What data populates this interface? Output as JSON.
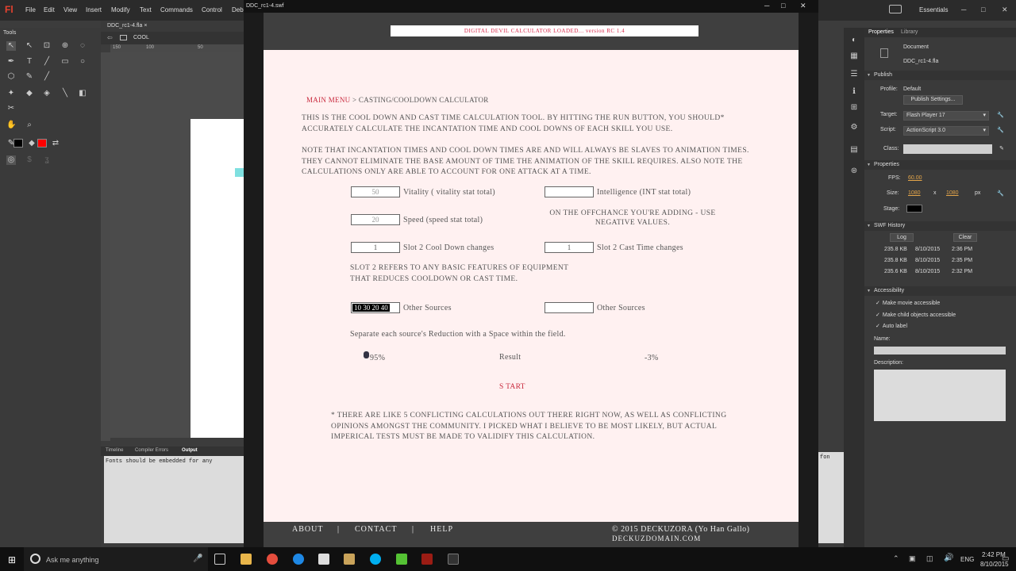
{
  "ide": {
    "logo": "Fl",
    "menus": [
      "File",
      "Edit",
      "View",
      "Insert",
      "Modify",
      "Text",
      "Commands",
      "Control",
      "Deb"
    ],
    "workspace": "Essentials",
    "doc_tab": "DDC_rc1-4.fla",
    "scene": "COOL",
    "tools_header": "Tools",
    "ruler_marks": [
      "150",
      "100",
      "50"
    ],
    "bottom_tabs": [
      "Timeline",
      "Compiler Errors",
      "Output"
    ],
    "output_text": "Fonts should be embedded for any",
    "output_text_right": "fon"
  },
  "properties": {
    "tabs": [
      "Properties",
      "Library"
    ],
    "doc_type": "Document",
    "doc_name": "DDC_rc1-4.fla",
    "publish_header": "Publish",
    "profile_label": "Profile:",
    "profile_value": "Default",
    "publish_settings_btn": "Publish Settings...",
    "target_label": "Target:",
    "target_value": "Flash Player 17",
    "script_label": "Script:",
    "script_value": "ActionScript 3.0",
    "class_label": "Class:",
    "props_header": "Properties",
    "fps_label": "FPS:",
    "fps_value": "60.00",
    "size_label": "Size:",
    "size_w": "1080",
    "size_x": "x",
    "size_h": "1080",
    "size_unit": "px",
    "stage_label": "Stage:",
    "stage_color": "#000000",
    "swf_history_header": "SWF History",
    "log_btn": "Log",
    "clear_btn": "Clear",
    "history": [
      {
        "size": "235.8 KB",
        "date": "8/10/2015",
        "time": "2:36 PM"
      },
      {
        "size": "235.8 KB",
        "date": "8/10/2015",
        "time": "2:35 PM"
      },
      {
        "size": "235.6 KB",
        "date": "8/10/2015",
        "time": "2:32 PM"
      }
    ],
    "accessibility_header": "Accessibility",
    "chk_movie": "Make movie accessible",
    "chk_child": "Make child objects accessible",
    "chk_auto": "Auto label",
    "name_label": "Name:",
    "desc_label": "Description:"
  },
  "swf": {
    "window_title": "DDC_rc1-4.swf",
    "loaded_text": "DIGITAL DEVIL CALCULATOR LOADED... version RC 1.4",
    "crumb_main": "MAIN MENU",
    "crumb_rest": " > CASTING/COOLDOWN CALCULATOR",
    "intro": "This is the cool down and cast time calculation tool.  By hitting the run button, you should* accurately calculate the incantation time and cool downs of each skill you use.",
    "note": "note that incantation times and cool down times are and will always be slaves to animation times. They cannot eliminate the base amount of time the animation of the skill requires. Also note the calculations only are able to account for one attack at a time.",
    "vitality_value": "50",
    "vitality_label": "Vitality ( vitality stat total)",
    "intelligence_value": "",
    "intelligence_label": "Intelligence (INT stat total)",
    "speed_value": "20",
    "speed_label": "Speed (speed stat total)",
    "offchance_note": "On the offchance you're adding - use negative values.",
    "slot2_cd_value": "1",
    "slot2_cd_label": "Slot 2 Cool Down changes",
    "slot2_ct_value": "1",
    "slot2_ct_label": "Slot 2 Cast Time changes",
    "slot2_note": "Slot 2 refers to any Basic Features of equipment that reduces cooldown or Cast Time.",
    "other_left_value": "10 30 20 40",
    "other_left_label": "Other Sources",
    "other_right_value": "",
    "other_right_label": "Other Sources",
    "separate_note": "Separate each source's Reduction with a Space within the field.",
    "result_left": "95%",
    "result_label": "Result",
    "result_right": "-3%",
    "start": "S tart",
    "disclaimer": "* There are like 5 conflicting calculations out there right now, as well as conflicting opinions amongst the community. I picked what I believe to be most likely, but actual imperical tests must be made to validify this calculation.",
    "footer_about": "About",
    "footer_sep1": "|",
    "footer_contact": "Contact",
    "footer_sep2": "|",
    "footer_help": "Help",
    "footer_copy": "© 2015 DECKUZORA (Yo Han Gallo)",
    "footer_domain": "deckuzdomain.com"
  },
  "taskbar": {
    "search_placeholder": "Ask me anything",
    "lang": "ENG",
    "time": "2:42 PM",
    "date": "8/10/2015"
  }
}
